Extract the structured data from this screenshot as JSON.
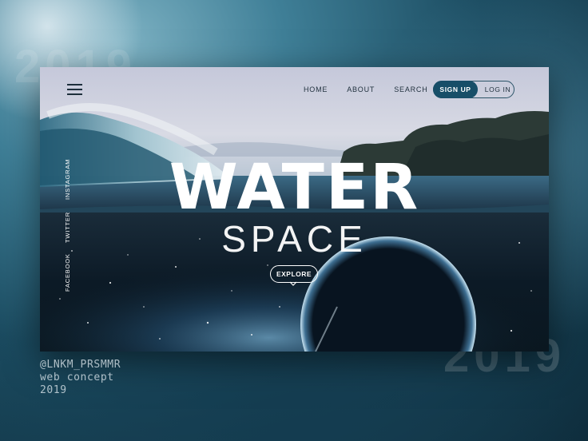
{
  "background": {
    "year_top": "2019",
    "year_bottom": "2019"
  },
  "header": {
    "nav": [
      {
        "label": "HOME"
      },
      {
        "label": "ABOUT"
      },
      {
        "label": "SEARCH"
      }
    ],
    "signup_label": "SIGN UP",
    "login_label": "LOG IN"
  },
  "social": [
    {
      "label": "INSTAGRAM"
    },
    {
      "label": "TWITTER"
    },
    {
      "label": "FACEBOOK"
    }
  ],
  "hero": {
    "title": "WATER",
    "subtitle": "SPACE",
    "cta_label": "EXPLORE"
  },
  "credits": {
    "handle": "@LNKM_PRSMMR",
    "project": "web concept",
    "year": "2019"
  },
  "colors": {
    "accent": "#174e68",
    "sky": "#c9cfdc",
    "ocean": "#1d3a4d",
    "deep": "#08141f"
  },
  "icons": {
    "menu": "hamburger-icon",
    "cta": "chevron-down-icon"
  }
}
